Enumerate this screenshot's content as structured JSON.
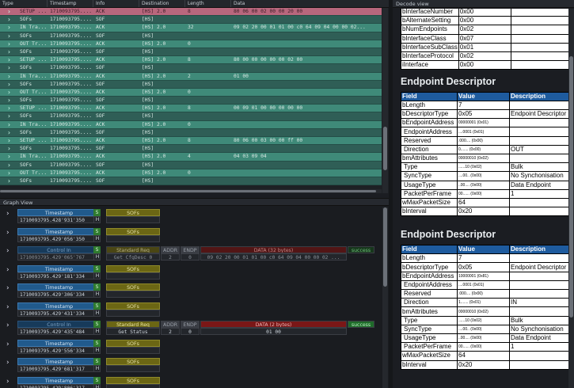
{
  "packet_list": {
    "columns": [
      "Type",
      "Timestamp",
      "Info",
      "Destination",
      "Length",
      "Data"
    ],
    "rows": [
      {
        "kind": "sel",
        "type": "SETUP ...",
        "ts": "1710093795....",
        "info": "ACK",
        "dest": "[HS] 2.0",
        "len": "8",
        "data": "80 06 00 02 00 00 20 00"
      },
      {
        "kind": "sof",
        "type": "SOFs",
        "ts": "1710093795....",
        "info": "SOF",
        "dest": "[HS]",
        "len": "",
        "data": ""
      },
      {
        "kind": "in",
        "type": "IN Tra...",
        "ts": "1710093795....",
        "info": "ACK",
        "dest": "[HS] 2.0",
        "len": "32",
        "data": "09 02 20 00 01 01 00 c0 64 09 04 00 00 02..."
      },
      {
        "kind": "sof",
        "type": "SOFs",
        "ts": "1710093795....",
        "info": "SOF",
        "dest": "[HS]",
        "len": "",
        "data": ""
      },
      {
        "kind": "out",
        "type": "OUT Tr...",
        "ts": "1710093795....",
        "info": "ACK",
        "dest": "[HS] 2.0",
        "len": "0",
        "data": ""
      },
      {
        "kind": "sof",
        "type": "SOFs",
        "ts": "1710093795....",
        "info": "SOF",
        "dest": "[HS]",
        "len": "",
        "data": ""
      },
      {
        "kind": "setup",
        "type": "SETUP ...",
        "ts": "1710093795....",
        "info": "ACK",
        "dest": "[HS] 2.0",
        "len": "8",
        "data": "80 00 00 00 00 00 02 00"
      },
      {
        "kind": "sof",
        "type": "SOFs",
        "ts": "1710093795....",
        "info": "SOF",
        "dest": "[HS]",
        "len": "",
        "data": ""
      },
      {
        "kind": "in",
        "type": "IN Tra...",
        "ts": "1710093795....",
        "info": "ACK",
        "dest": "[HS] 2.0",
        "len": "2",
        "data": "01 00"
      },
      {
        "kind": "sof",
        "type": "SOFs",
        "ts": "1710093795....",
        "info": "SOF",
        "dest": "[HS]",
        "len": "",
        "data": ""
      },
      {
        "kind": "out",
        "type": "OUT Tr...",
        "ts": "1710093795....",
        "info": "ACK",
        "dest": "[HS] 2.0",
        "len": "0",
        "data": ""
      },
      {
        "kind": "sof",
        "type": "SOFs",
        "ts": "1710093795....",
        "info": "SOF",
        "dest": "[HS]",
        "len": "",
        "data": ""
      },
      {
        "kind": "setup",
        "type": "SETUP ...",
        "ts": "1710093795....",
        "info": "ACK",
        "dest": "[HS] 2.0",
        "len": "8",
        "data": "00 09 01 00 00 00 00 00"
      },
      {
        "kind": "sof",
        "type": "SOFs",
        "ts": "1710093795....",
        "info": "SOF",
        "dest": "[HS]",
        "len": "",
        "data": ""
      },
      {
        "kind": "in",
        "type": "IN Tra...",
        "ts": "1710093795....",
        "info": "ACK",
        "dest": "[HS] 2.0",
        "len": "0",
        "data": ""
      },
      {
        "kind": "sof",
        "type": "SOFs",
        "ts": "1710093795....",
        "info": "SOF",
        "dest": "[HS]",
        "len": "",
        "data": ""
      },
      {
        "kind": "setup",
        "type": "SETUP ...",
        "ts": "1710093795....",
        "info": "ACK",
        "dest": "[HS] 2.0",
        "len": "8",
        "data": "80 06 00 03 00 00 ff 00"
      },
      {
        "kind": "sof",
        "type": "SOFs",
        "ts": "1710093795....",
        "info": "SOF",
        "dest": "[HS]",
        "len": "",
        "data": ""
      },
      {
        "kind": "in",
        "type": "IN Tra...",
        "ts": "1710093795....",
        "info": "ACK",
        "dest": "[HS] 2.0",
        "len": "4",
        "data": "04 03 09 04"
      },
      {
        "kind": "sof",
        "type": "SOFs",
        "ts": "1710093795....",
        "info": "SOF",
        "dest": "[HS]",
        "len": "",
        "data": ""
      },
      {
        "kind": "out",
        "type": "OUT Tr...",
        "ts": "1710093795....",
        "info": "ACK",
        "dest": "[HS] 2.0",
        "len": "0",
        "data": ""
      },
      {
        "kind": "sof",
        "type": "SOFs",
        "ts": "1710093795....",
        "info": "SOF",
        "dest": "[HS]",
        "len": "",
        "data": ""
      }
    ]
  },
  "graph_view": {
    "title": "Graph View",
    "rows": [
      {
        "kind": "sof",
        "label": "Timestamp",
        "ts": "1710093795.428'931'350",
        "s": "S",
        "h": "H",
        "sof_label": "SOFs"
      },
      {
        "kind": "sof",
        "label": "Timestamp",
        "ts": "1710093795.429'056'350",
        "s": "S",
        "h": "H",
        "sof_label": "SOFs"
      },
      {
        "kind": "ctl",
        "dim": true,
        "label": "Control In",
        "ts": "1710093795.429'065'767",
        "s": "S",
        "h": "H",
        "req": "Standard Req",
        "req_val": "Get CfgDesc 0",
        "addr": "ADDR",
        "addr_val": "2",
        "endp": "ENDP",
        "endp_val": "0",
        "data_hdr": "DATA (32 bytes)",
        "data_val": "09 02 20 00 01 01 00 c0 64 09 04 00 00 02 ...",
        "status": "success"
      },
      {
        "kind": "sof",
        "label": "Timestamp",
        "ts": "1710093795.429'181'334",
        "s": "S",
        "h": "H",
        "sof_label": "SOFs"
      },
      {
        "kind": "sof",
        "label": "Timestamp",
        "ts": "1710093795.429'306'334",
        "s": "S",
        "h": "H",
        "sof_label": "SOFs"
      },
      {
        "kind": "sof",
        "label": "Timestamp",
        "ts": "1710093795.429'431'334",
        "s": "S",
        "h": "H",
        "sof_label": "SOFs"
      },
      {
        "kind": "ctl",
        "dim": false,
        "label": "Control In",
        "ts": "1710093795.429'435'484",
        "s": "S",
        "h": "H",
        "req": "Standard Req",
        "req_val": "Get Status",
        "addr": "ADDR",
        "addr_val": "2",
        "endp": "ENDP",
        "endp_val": "0",
        "data_hdr": "DATA (2 bytes)",
        "data_val": "01 00",
        "status": "success"
      },
      {
        "kind": "sof",
        "label": "Timestamp",
        "ts": "1710093795.429'556'334",
        "s": "S",
        "h": "H",
        "sof_label": "SOFs"
      },
      {
        "kind": "sof",
        "label": "Timestamp",
        "ts": "1710093795.429'681'317",
        "s": "S",
        "h": "H",
        "sof_label": "SOFs"
      },
      {
        "kind": "sof",
        "label": "Timestamp",
        "ts": "1710093795.429'806'317",
        "s": "S",
        "h": "H",
        "sof_label": "SOFs"
      }
    ]
  },
  "decode_view": {
    "title": "Decode view",
    "top_rows": [
      {
        "k": "bInterfaceNumber",
        "v": "0x00"
      },
      {
        "k": "bAlternateSetting",
        "v": "0x00"
      },
      {
        "k": "bNumEndpoints",
        "v": "0x02"
      },
      {
        "k": "bInterfaceClass",
        "v": "0x07"
      },
      {
        "k": "bInterfaceSubClass",
        "v": "0x01"
      },
      {
        "k": "bInterfaceProtocol",
        "v": "0x02"
      },
      {
        "k": "iInterface",
        "v": "0x00"
      }
    ],
    "sections": [
      {
        "heading": "Endpoint Descriptor",
        "header": [
          "Field",
          "Value",
          "Description"
        ],
        "rows": [
          {
            "k": "bLength",
            "v": "7",
            "d": ""
          },
          {
            "k": "bDescriptorType",
            "v": "0x05",
            "d": "Endpoint Descriptor"
          },
          {
            "k": "bEndpointAddress",
            "v": "00000001 (0x01)",
            "d": "",
            "small": true
          },
          {
            "k": "EndpointAddress",
            "v": "....0001 (0x01)",
            "d": "",
            "small": true,
            "ind": true
          },
          {
            "k": "Reserved",
            "v": ".000.... (0x00)",
            "d": "",
            "small": true,
            "ind": true
          },
          {
            "k": "Direction",
            "v": "0....... (0x00)",
            "d": "OUT",
            "small": true,
            "ind": true
          },
          {
            "k": "bmAttributes",
            "v": "00000010 (0x02)",
            "d": "",
            "small": true
          },
          {
            "k": "Type",
            "v": "......10 (0x02)",
            "d": "Bulk",
            "small": true,
            "ind": true
          },
          {
            "k": "SyncType",
            "v": "....00.. (0x00)",
            "d": "No Synchonisation",
            "small": true,
            "ind": true
          },
          {
            "k": "UsageType",
            "v": "..00.... (0x00)",
            "d": "Data Endpoint",
            "small": true,
            "ind": true
          },
          {
            "k": "PacketPerFrame",
            "v": "00...... (0x00)",
            "d": "1",
            "small": true,
            "ind": true
          },
          {
            "k": "wMaxPacketSize",
            "v": "64",
            "d": ""
          },
          {
            "k": "bInterval",
            "v": "0x20",
            "d": ""
          }
        ]
      },
      {
        "heading": "Endpoint Descriptor",
        "header": [
          "Field",
          "Value",
          "Description"
        ],
        "rows": [
          {
            "k": "bLength",
            "v": "7",
            "d": ""
          },
          {
            "k": "bDescriptorType",
            "v": "0x05",
            "d": "Endpoint Descriptor"
          },
          {
            "k": "bEndpointAddress",
            "v": "10000001 (0x81)",
            "d": "",
            "small": true
          },
          {
            "k": "EndpointAddress",
            "v": "....0001 (0x01)",
            "d": "",
            "small": true,
            "ind": true
          },
          {
            "k": "Reserved",
            "v": ".000.... (0x00)",
            "d": "",
            "small": true,
            "ind": true
          },
          {
            "k": "Direction",
            "v": "1....... (0x01)",
            "d": "IN",
            "small": true,
            "ind": true
          },
          {
            "k": "bmAttributes",
            "v": "00000010 (0x02)",
            "d": "",
            "small": true
          },
          {
            "k": "Type",
            "v": "......10 (0x02)",
            "d": "Bulk",
            "small": true,
            "ind": true
          },
          {
            "k": "SyncType",
            "v": "....00.. (0x00)",
            "d": "No Synchonisation",
            "small": true,
            "ind": true
          },
          {
            "k": "UsageType",
            "v": "..00.... (0x00)",
            "d": "Data Endpoint",
            "small": true,
            "ind": true
          },
          {
            "k": "PacketPerFrame",
            "v": "00...... (0x00)",
            "d": "1",
            "small": true,
            "ind": true
          },
          {
            "k": "wMaxPacketSize",
            "v": "64",
            "d": ""
          },
          {
            "k": "bInterval",
            "v": "0x20",
            "d": ""
          }
        ]
      }
    ]
  }
}
